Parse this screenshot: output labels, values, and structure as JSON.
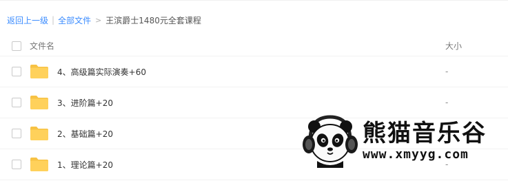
{
  "breadcrumb": {
    "back": "返回上一级",
    "separator": "|",
    "all_files": "全部文件",
    "arrow": ">",
    "current": "王滨爵士1480元全套课程"
  },
  "table": {
    "header": {
      "name": "文件名",
      "size": "大小"
    },
    "rows": [
      {
        "name": "4、高级篇实际演奏+60",
        "size": "-",
        "icon": "folder-icon"
      },
      {
        "name": "3、进阶篇+20",
        "size": "-",
        "icon": "folder-icon"
      },
      {
        "name": "2、基础篇+20",
        "size": "-",
        "icon": "folder-icon"
      },
      {
        "name": "1、理论篇+20",
        "size": "-",
        "icon": "folder-icon"
      }
    ]
  },
  "watermark": {
    "title": "熊猫音乐谷",
    "url": "www.xmyyg.com"
  },
  "colors": {
    "link": "#3b8cff",
    "folder": "#ffd15b",
    "folder_tab": "#f7c244"
  }
}
